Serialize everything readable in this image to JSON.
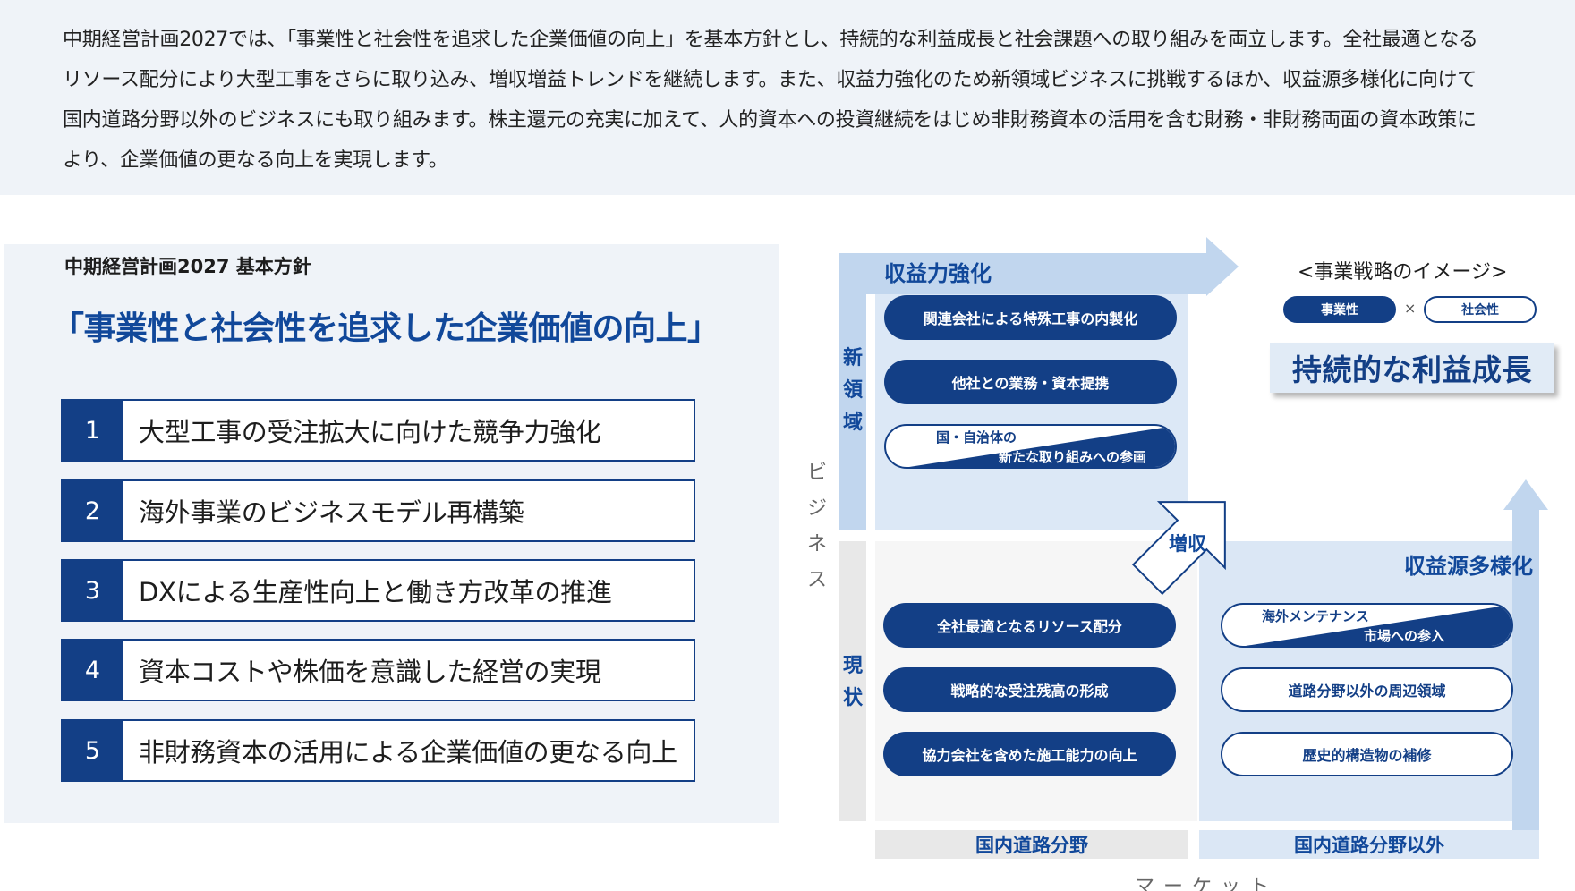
{
  "intro": {
    "text": "中期経営計画2027では、「事業性と社会性を追求した企業価値の向上」を基本方針とし、持続的な利益成長と社会課題への取り組みを両立します。全社最適となるリソース配分により大型工事をさらに取り込み、増収増益トレンドを継続します。また、収益力強化のため新領域ビジネスに挑戦するほか、収益源多様化に向けて国内道路分野以外のビジネスにも取り組みます。株主還元の充実に加えて、人的資本への投資継続をはじめ非財務資本の活用を含む財務・非財務両面の資本政策により、企業価値の更なる向上を実現します。"
  },
  "policy_panel": {
    "heading": "中期経営計画2027 基本方針",
    "title": "「事業性と社会性を追求した企業価値の向上」",
    "items": [
      {
        "num": "1",
        "text": "大型工事の受注拡大に向けた競争力強化"
      },
      {
        "num": "2",
        "text": "海外事業のビジネスモデル再構築"
      },
      {
        "num": "3",
        "text": "DXによる生産性向上と働き方改革の推進"
      },
      {
        "num": "4",
        "text": "資本コストや株価を意識した経営の実現"
      },
      {
        "num": "5",
        "text": "非財務資本の活用による企業価値の更なる向上"
      }
    ]
  },
  "strategy_diagram": {
    "top_arrow_label": "収益力強化",
    "right_arrow_label": "収益源多様化",
    "increase_label": "増収",
    "row_new": "新領域",
    "row_current": "現状",
    "axis_y": "ビジネス",
    "axis_x": "マーケット",
    "col_domestic": "国内道路分野",
    "col_other": "国内道路分野以外",
    "new_domain_items": [
      {
        "text": "関連会社による特殊工事の内製化",
        "style": "filled"
      },
      {
        "text": "他社との業務・資本提携",
        "style": "filled"
      },
      {
        "text_top": "国・自治体の",
        "text_bottom": "新たな取り組みへの参画",
        "style": "split"
      }
    ],
    "current_items": [
      {
        "text": "全社最適となるリソース配分",
        "style": "filled"
      },
      {
        "text": "戦略的な受注残高の形成",
        "style": "filled"
      },
      {
        "text": "協力会社を含めた施工能力の向上",
        "style": "filled"
      }
    ],
    "other_items": [
      {
        "text_top": "海外メンテナンス",
        "text_bottom": "市場への参入",
        "style": "split"
      },
      {
        "text": "道路分野以外の周辺領域",
        "style": "outline"
      },
      {
        "text": "歴史的構造物の補修",
        "style": "outline"
      }
    ],
    "image_panel": {
      "title": "<事業戦略のイメージ>",
      "tag_business": "事業性",
      "times": "×",
      "tag_social": "社会性",
      "result": "持続的な利益成長"
    },
    "colors": {
      "navy": "#133f86",
      "title_blue": "#11489a",
      "band": "#c1d6ee"
    }
  }
}
